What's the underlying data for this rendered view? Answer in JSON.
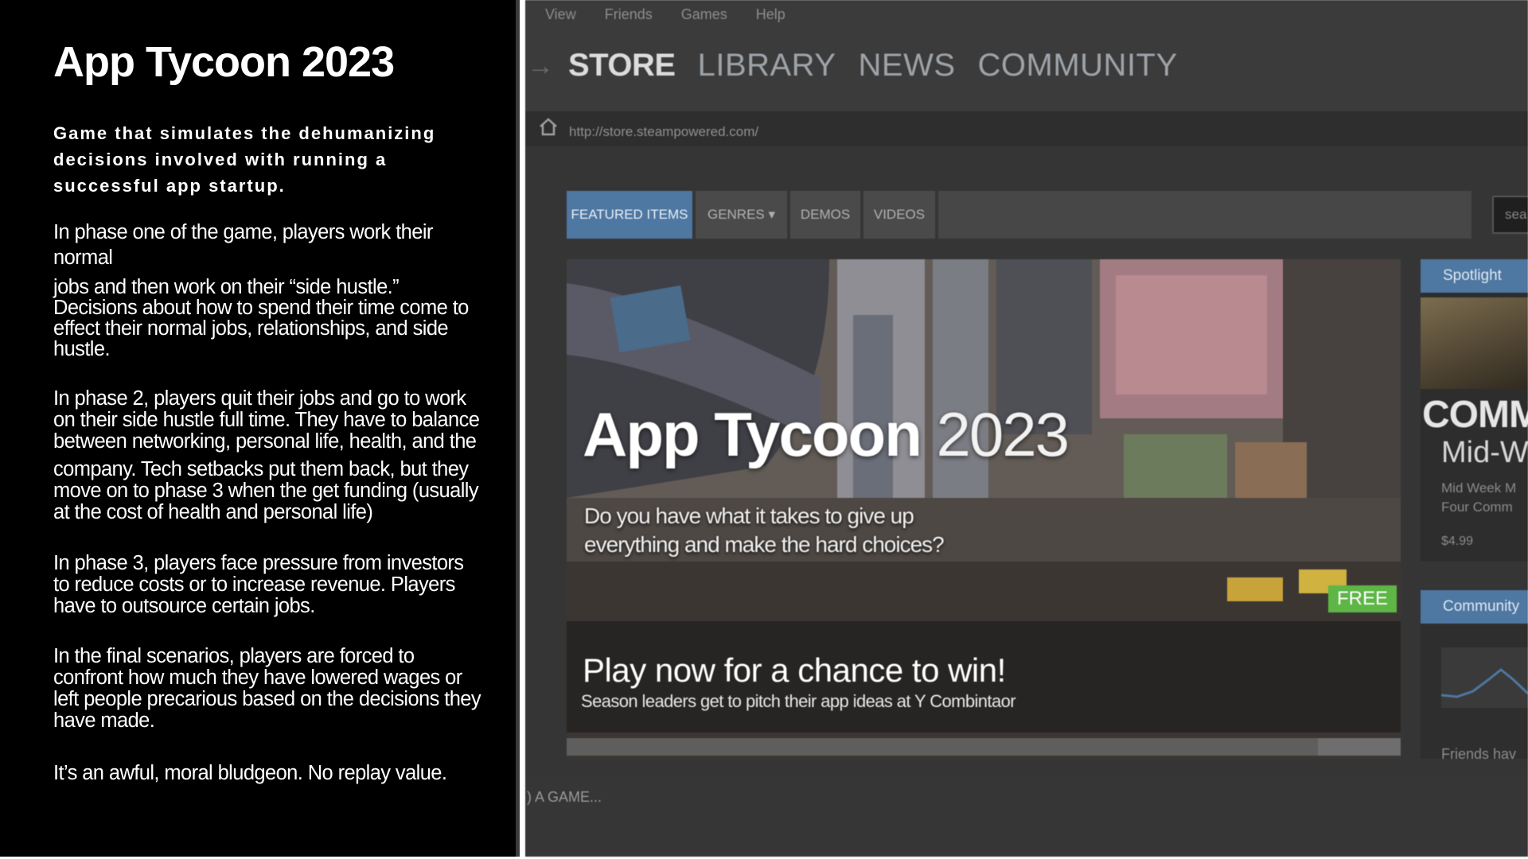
{
  "panel": {
    "title": "App Tycoon 2023",
    "subtitle": "Game that simulates the dehumanizing decisions involved with running a successful app startup.",
    "p1a": "In phase one of the game, players work their normal",
    "p1b": "jobs and then work on their “side hustle.” Decisions about how to spend their time come to effect their normal jobs, relationships, and side hustle.",
    "p2a": "In phase 2, players quit their jobs and go to work on their side hustle full time. They have to balance between networking, personal life, health, and the",
    "p2b": "company. Tech setbacks put them back, but they move on to phase 3 when the get funding (usually at the cost of health and personal life)",
    "p3": "In phase 3, players face pressure from investors to reduce costs or to increase revenue. Players have to outsource certain jobs.",
    "p4": "In the final scenarios, players are forced to confront how much they have lowered wages or left people precarious based on the decisions they have made.",
    "p5": "It’s an awful, moral bludgeon. No replay value."
  },
  "steam": {
    "menu": [
      "View",
      "Friends",
      "Games",
      "Help"
    ],
    "nav": [
      "STORE",
      "LIBRARY",
      "NEWS",
      "COMMUNITY"
    ],
    "url": "http://store.steampowered.com/",
    "tabs": [
      "FEATURED ITEMS",
      "GENRES ▾",
      "DEMOS",
      "VIDEOS"
    ],
    "search_label": "sea",
    "hero": {
      "title_bold": "App Tycoon",
      "title_year": " 2023",
      "tagline": "Do you have what it takes to give up everything and make the hard choices?",
      "badge": "FREE",
      "cta": "Play now for a chance to win!",
      "cta_sub": "Season leaders get to pitch their app ideas at Y Combintaor"
    },
    "spotlight": {
      "header": "Spotlight",
      "title1": "COMMA",
      "title2": "Mid-W",
      "desc1": "Mid Week M",
      "desc2": "Four Comm",
      "price": "$4.99"
    },
    "community": {
      "header": "Community",
      "friends": "Friends hav"
    },
    "bottom": ") A GAME..."
  },
  "colors": {
    "accent": "#4e77a2",
    "free_badge": "#5db646"
  }
}
